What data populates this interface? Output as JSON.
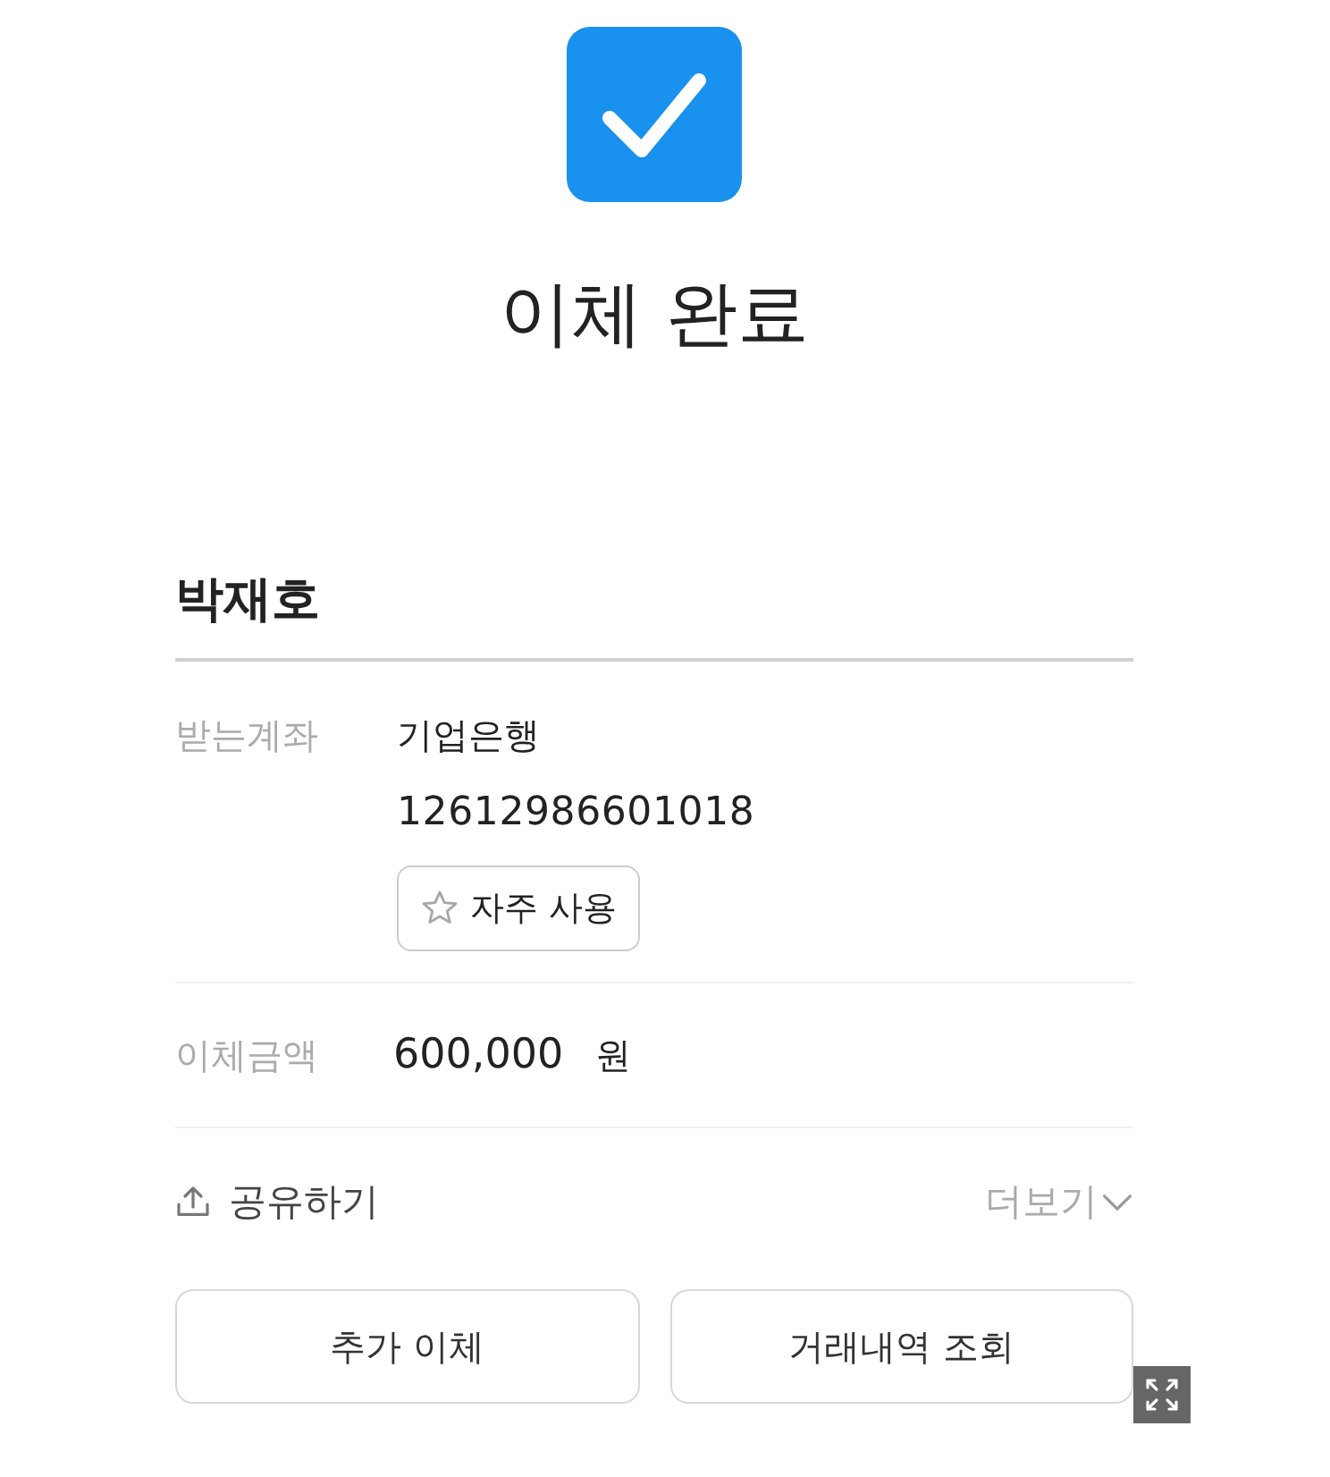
{
  "header": {
    "title": "이체 완료"
  },
  "recipient": {
    "name": "박재호"
  },
  "details": [
    {
      "kind": "account",
      "label": "받는계좌",
      "bank": "기업은행",
      "account_number": "12612986601018",
      "favorite": {
        "label": "자주 사용",
        "on": false
      }
    },
    {
      "kind": "amount",
      "label": "이체금액",
      "value": "600,000",
      "unit": "원"
    }
  ],
  "links": {
    "share": "공유하기",
    "more": "더보기"
  },
  "buttons": [
    "추가 이체",
    "거래내역 조회"
  ]
}
